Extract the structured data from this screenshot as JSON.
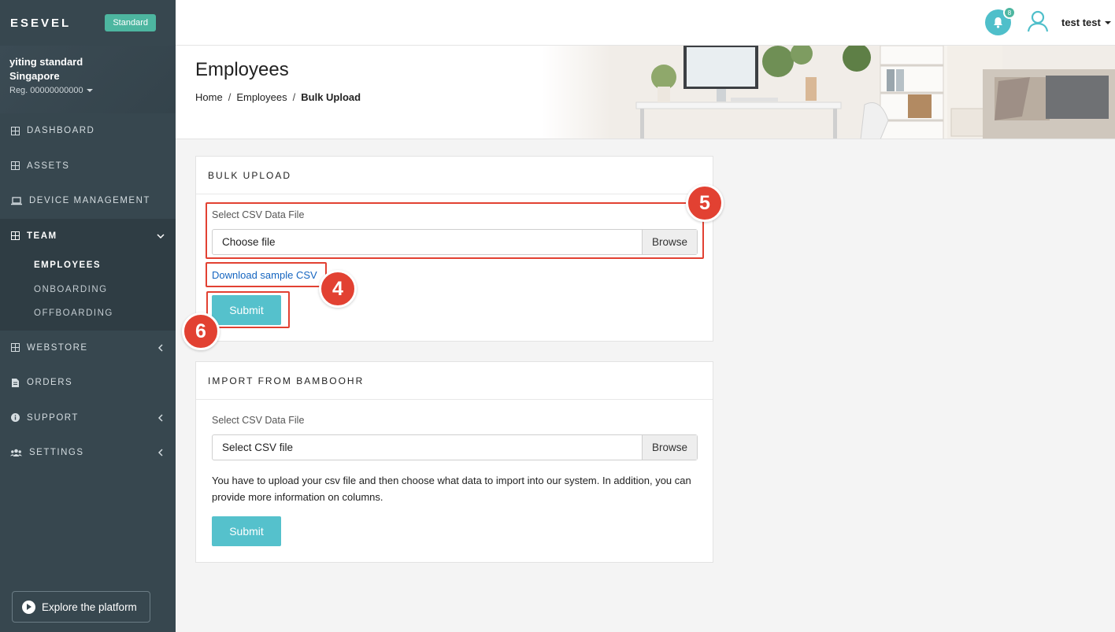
{
  "brand": {
    "name": "ESEVEL",
    "plan": "Standard"
  },
  "account": {
    "name": "yiting standard",
    "location": "Singapore",
    "reg": "Reg. 00000000000"
  },
  "sidebar": {
    "items": [
      {
        "label": "DASHBOARD",
        "icon": "grid-icon"
      },
      {
        "label": "ASSETS",
        "icon": "grid-icon"
      },
      {
        "label": "DEVICE MANAGEMENT",
        "icon": "laptop-icon"
      },
      {
        "label": "TEAM",
        "icon": "grid-icon"
      },
      {
        "label": "WEBSTORE",
        "icon": "grid-icon"
      },
      {
        "label": "ORDERS",
        "icon": "file-icon"
      },
      {
        "label": "SUPPORT",
        "icon": "info-icon"
      },
      {
        "label": "SETTINGS",
        "icon": "users-icon"
      }
    ],
    "team_sub": [
      {
        "label": "EMPLOYEES"
      },
      {
        "label": "ONBOARDING"
      },
      {
        "label": "OFFBOARDING"
      }
    ],
    "explore": "Explore the platform"
  },
  "topbar": {
    "notifications": "8",
    "user": "test test"
  },
  "header": {
    "title": "Employees",
    "breadcrumb": [
      "Home",
      "Employees",
      "Bulk Upload"
    ]
  },
  "bulk_upload": {
    "title": "BULK UPLOAD",
    "label": "Select CSV Data File",
    "file_placeholder": "Choose file",
    "browse": "Browse",
    "sample_link": "Download sample CSV",
    "submit": "Submit"
  },
  "bamboohr": {
    "title": "IMPORT FROM BAMBOOHR",
    "label": "Select CSV Data File",
    "file_placeholder": "Select CSV file",
    "browse": "Browse",
    "help": "You have to upload your csv file and then choose what data to import into our system. In addition, you can provide more information on columns.",
    "submit": "Submit"
  },
  "annotations": {
    "m5": "5",
    "m4": "4",
    "m6": "6"
  },
  "colors": {
    "sidebar": "#37474f",
    "accent": "#55c1cc",
    "badge": "#4db6a0",
    "annotation": "#e24132"
  }
}
